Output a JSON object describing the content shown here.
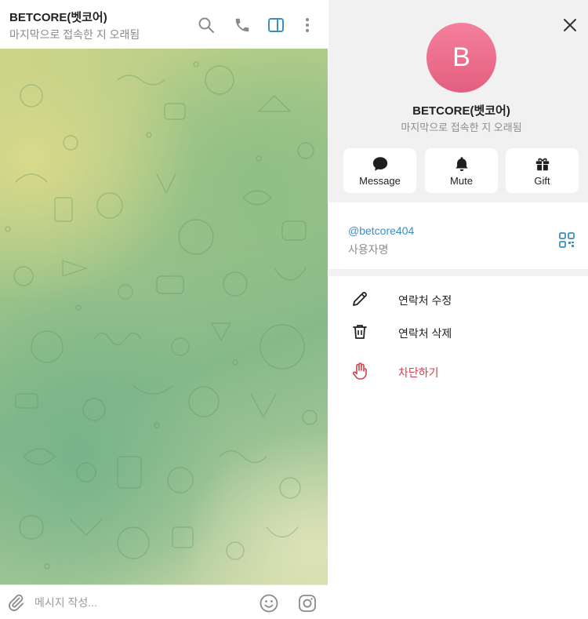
{
  "chat": {
    "title": "BETCORE(벳코어)",
    "status": "마지막으로 접속한 지 오래됨",
    "header_icons": [
      "search-icon",
      "phone-icon",
      "sidebar-toggle-icon",
      "more-vertical-icon"
    ],
    "composer": {
      "placeholder": "메시지 작성...",
      "icons": [
        "attach-icon",
        "emoji-icon",
        "sticker-icon"
      ]
    }
  },
  "profile": {
    "avatar_letter": "B",
    "avatar_color": "#ec6d8c",
    "name": "BETCORE(벳코어)",
    "status": "마지막으로 접속한 지 오래됨",
    "actions": [
      {
        "label": "Message",
        "icon": "chat-bubble-icon"
      },
      {
        "label": "Mute",
        "icon": "bell-icon"
      },
      {
        "label": "Gift",
        "icon": "gift-icon"
      }
    ],
    "username": "@betcore404",
    "username_label": "사용자명",
    "menu": [
      {
        "label": "연락처 수정",
        "icon": "pencil-icon"
      },
      {
        "label": "연락처 삭제",
        "icon": "trash-icon"
      },
      {
        "label": "차단하기",
        "icon": "hand-icon"
      }
    ]
  },
  "colors": {
    "accent": "#3a8fc3",
    "danger": "#d0424c",
    "panel_bg": "#f1f1f1"
  }
}
